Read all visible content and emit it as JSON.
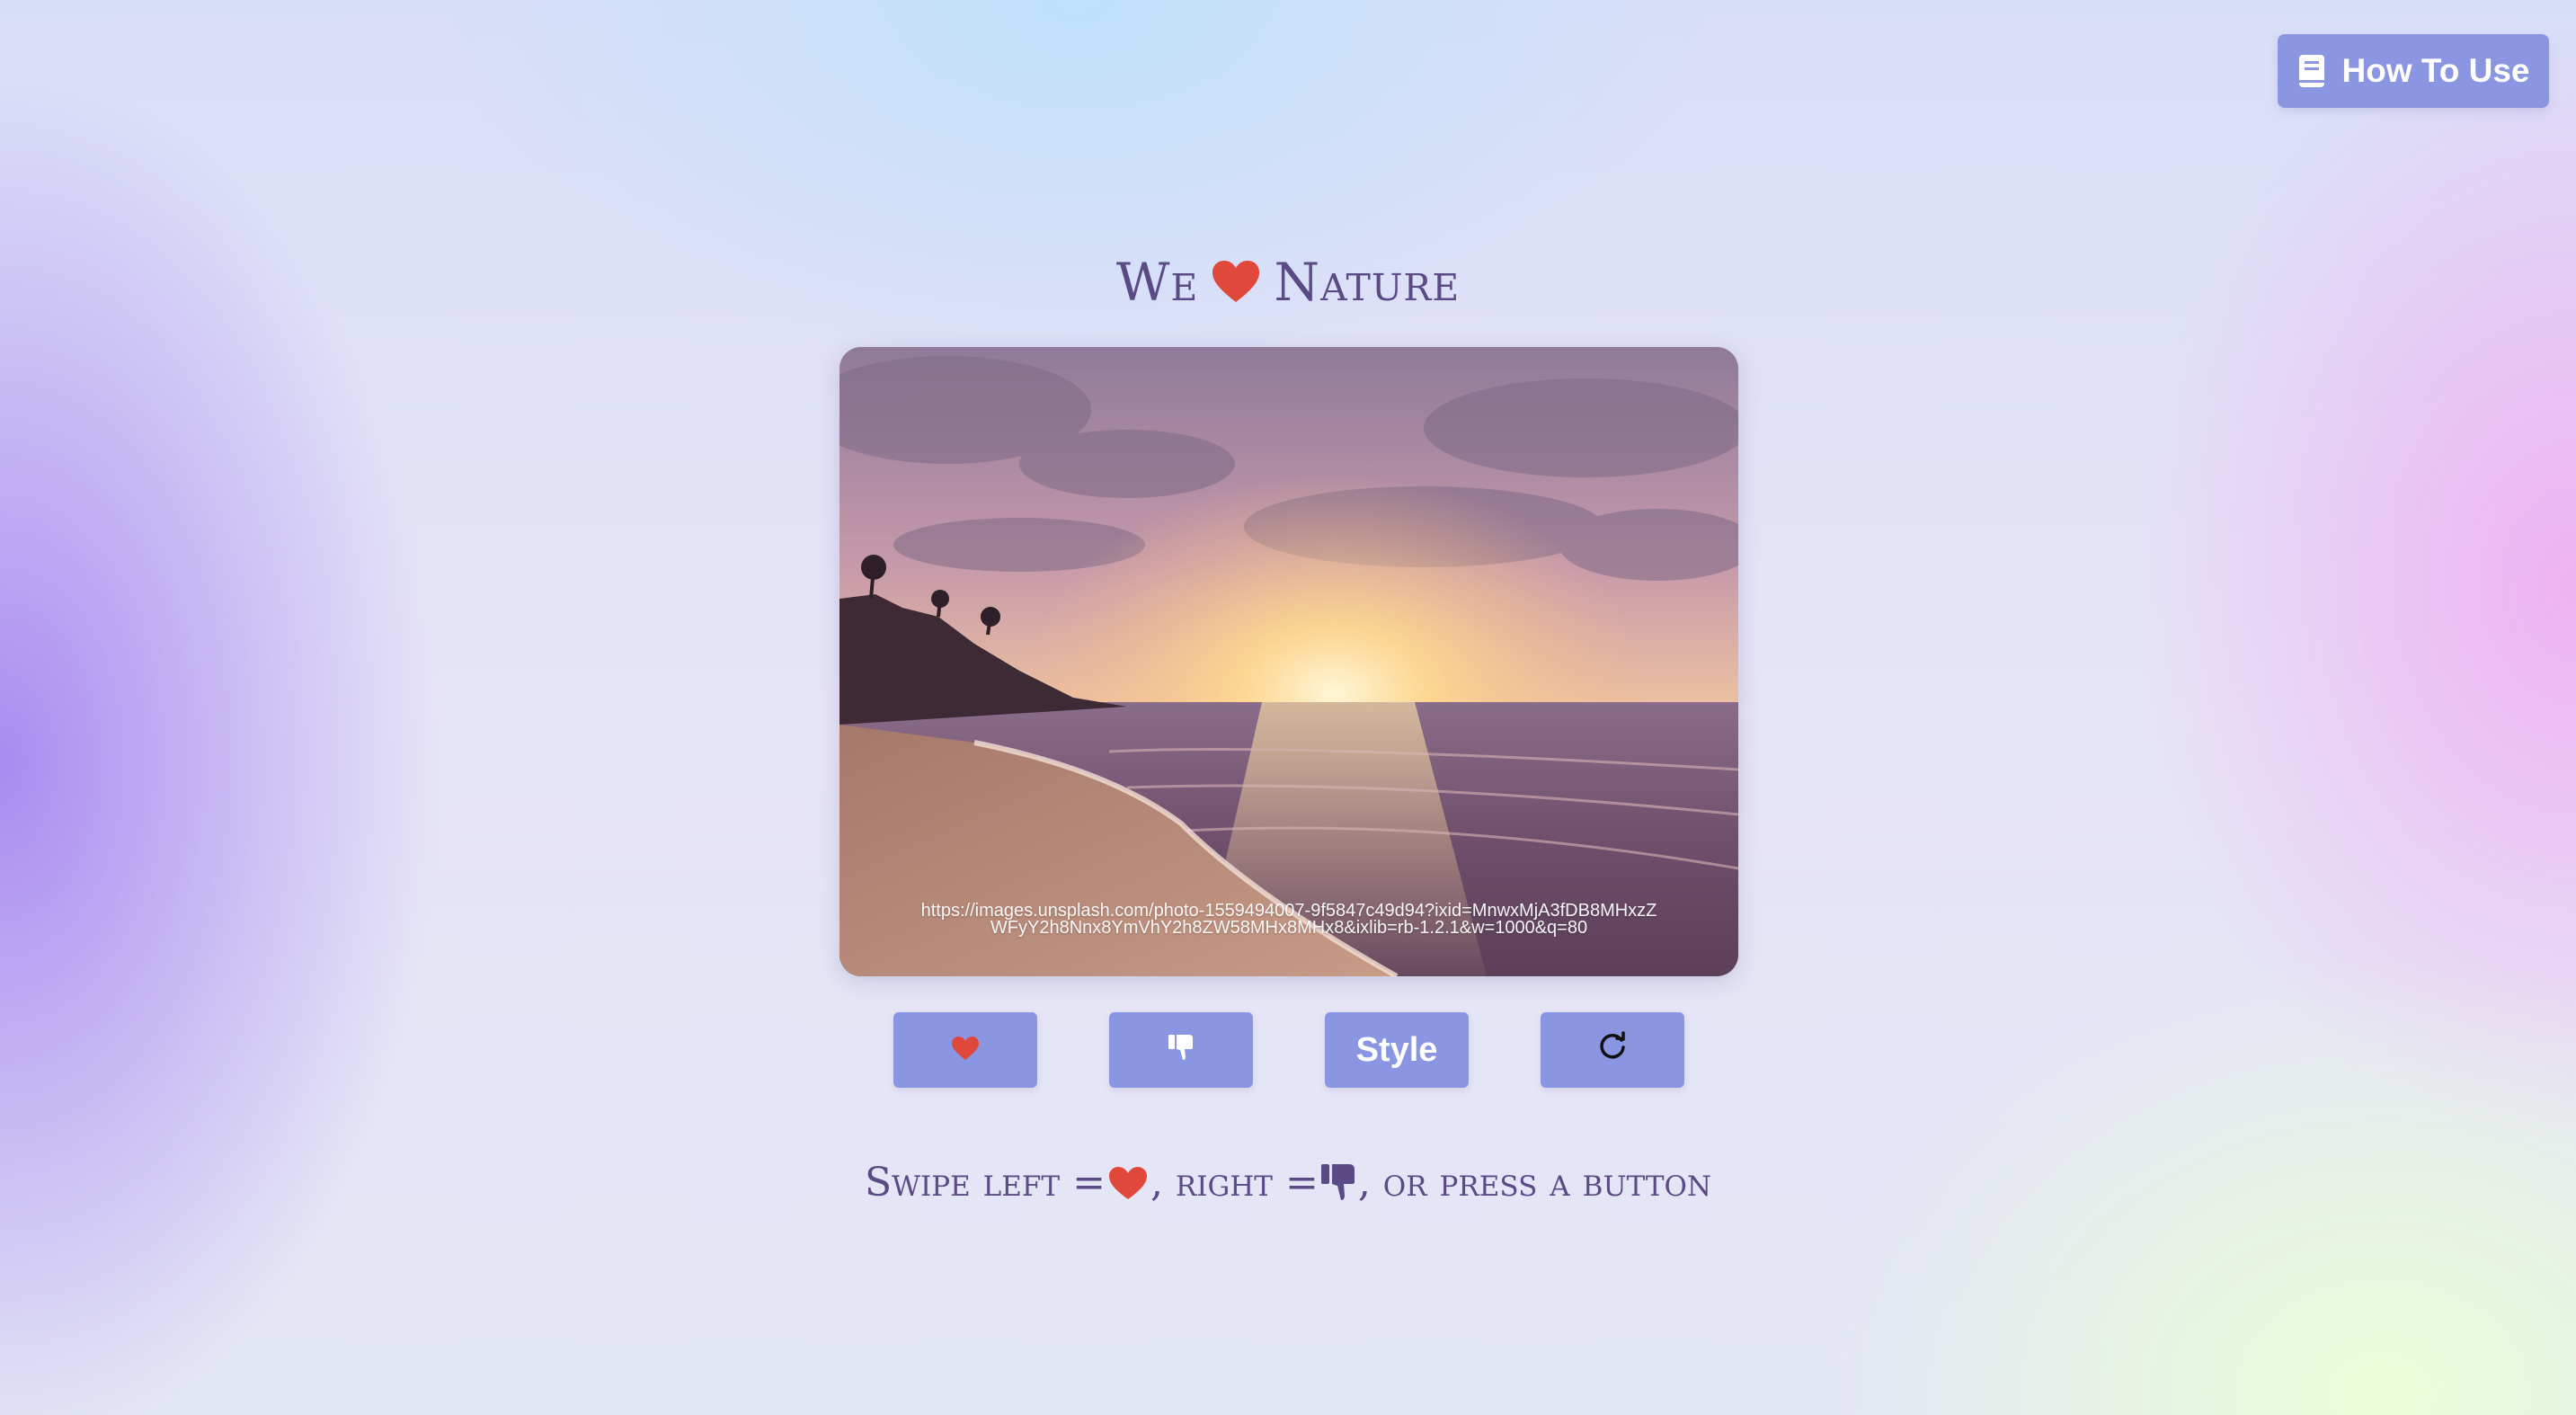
{
  "header": {
    "how_to_label": "How To Use",
    "how_to_icon": "book-icon"
  },
  "title": {
    "prefix": "We",
    "icon": "heart-icon",
    "suffix": "Nature",
    "heart_color": "#e0483c"
  },
  "photo": {
    "url_text": "https://images.unsplash.com/photo-1559494007-9f5847c49d94?ixid=MnwxMjA3fDB8MHxzZWFyY2h8Nnx8YmVhY2h8ZW58MHx8MHx8&ixlib=rb-1.2.1&w=1000&q=80"
  },
  "controls": {
    "like_icon": "heart-icon",
    "dislike_icon": "thumbs-down-icon",
    "style_label": "Style",
    "refresh_icon": "refresh-icon",
    "accent": "#8a96e2"
  },
  "instructions": {
    "part1": "Swipe left =",
    "part2": ", right =",
    "part3": ", or press a button"
  }
}
